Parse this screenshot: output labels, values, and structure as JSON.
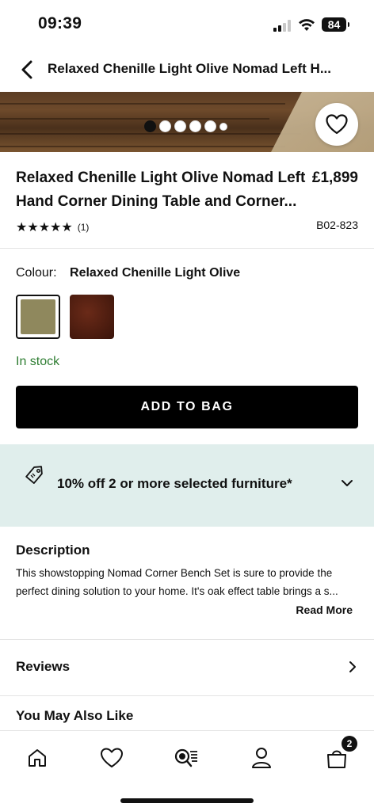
{
  "status_bar": {
    "time": "09:39",
    "battery": "84"
  },
  "header": {
    "title": "Relaxed Chenille Light Olive Nomad Left H..."
  },
  "product": {
    "title": "Relaxed Chenille Light Olive Nomad Left Hand Corner Dining Table and Corner...",
    "price": "£1,899",
    "stars": "★★★★★",
    "review_count": "(1)",
    "sku": "B02-823",
    "gallery_dots": 6,
    "gallery_active": 1
  },
  "colour": {
    "label": "Colour:",
    "value": "Relaxed Chenille Light Olive",
    "swatches": [
      {
        "name": "light-olive",
        "color": "#8f885d",
        "selected": true
      },
      {
        "name": "brown",
        "color": "#4a1b0e",
        "selected": false
      }
    ]
  },
  "stock": {
    "text": "In stock",
    "color": "#2e7d32"
  },
  "actions": {
    "add_to_bag": "ADD TO BAG"
  },
  "promo": {
    "text": "10% off 2 or more selected furniture*",
    "icon": "price-tag-icon",
    "background": "#e0eeec"
  },
  "description": {
    "heading": "Description",
    "line1": "This showstopping Nomad Corner Bench Set is sure to provide the",
    "line2": "perfect dining solution to your home. It's oak effect table brings a s...",
    "read_more": "Read More"
  },
  "reviews": {
    "label": "Reviews"
  },
  "recommendations": {
    "heading": "You May Also Like"
  },
  "tab_bar": {
    "items": [
      "home-icon",
      "heart-icon",
      "search-list-icon",
      "account-icon",
      "bag-icon"
    ],
    "bag_count": "2"
  }
}
